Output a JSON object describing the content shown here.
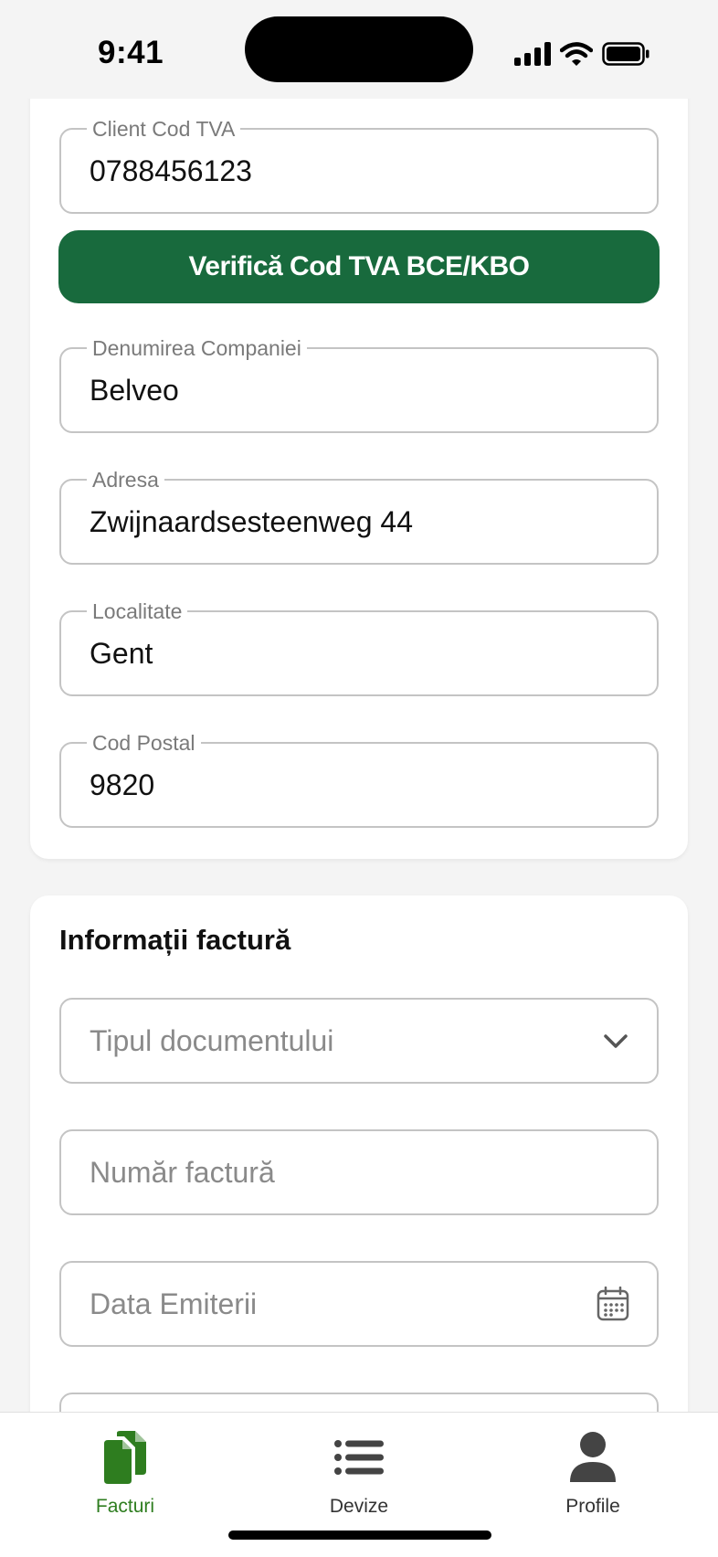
{
  "status_bar": {
    "time": "9:41"
  },
  "client_section": {
    "vat_field": {
      "label": "Client Cod TVA",
      "value": "0788456123"
    },
    "verify_button": "Verifică Cod TVA BCE/KBO",
    "company_field": {
      "label": "Denumirea Companiei",
      "value": "Belveo"
    },
    "address_field": {
      "label": "Adresa",
      "value": "Zwijnaardsesteenweg 44"
    },
    "city_field": {
      "label": "Localitate",
      "value": "Gent"
    },
    "postal_field": {
      "label": "Cod Postal",
      "value": "9820"
    }
  },
  "invoice_section": {
    "title": "Informații factură",
    "doc_type_placeholder": "Tipul documentului",
    "invoice_number_placeholder": "Număr factură",
    "issue_date_placeholder": "Data Emiterii"
  },
  "tabbar": {
    "tabs": [
      {
        "label": "Facturi",
        "icon": "documents-icon",
        "active": true
      },
      {
        "label": "Devize",
        "icon": "list-icon",
        "active": false
      },
      {
        "label": "Profile",
        "icon": "person-icon",
        "active": false
      }
    ]
  },
  "colors": {
    "primary": "#186a3d",
    "active_tab": "#2e7d1f",
    "border": "#c4c4c4"
  }
}
